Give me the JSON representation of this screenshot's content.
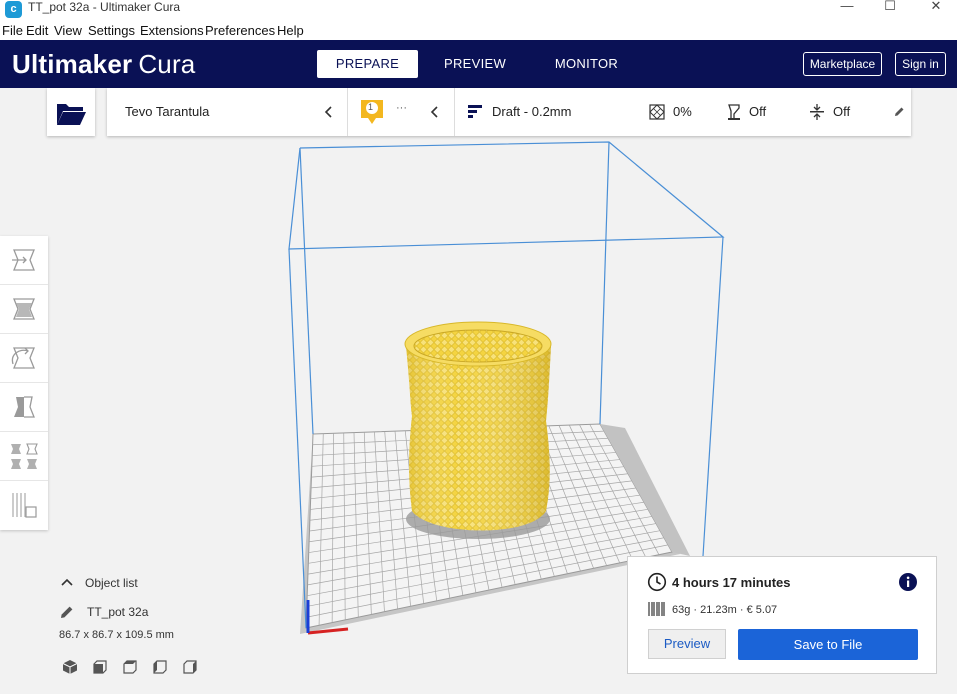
{
  "window": {
    "title": "TT_pot 32a - Ultimaker Cura",
    "app_icon_letter": "c",
    "minimize": "—",
    "maximize": "☐",
    "close": "✕"
  },
  "menu": [
    "File",
    "Edit",
    "View",
    "Settings",
    "Extensions",
    "Preferences",
    "Help"
  ],
  "header": {
    "logo_bold": "Ultimaker",
    "logo_light": "Cura",
    "tabs": [
      {
        "label": "PREPARE",
        "active": true
      },
      {
        "label": "PREVIEW",
        "active": false
      },
      {
        "label": "MONITOR",
        "active": false
      }
    ],
    "marketplace": "Marketplace",
    "sign_in": "Sign in"
  },
  "toolbar": {
    "printer_name": "Tevo Tarantula",
    "extruder_number": "1",
    "extruder_more": "···",
    "profile": "Draft - 0.2mm",
    "infill": "0%",
    "support": "Off",
    "adhesion": "Off"
  },
  "object_list": {
    "header": "Object list",
    "object_name": "TT_pot 32a",
    "dimensions": "86.7 x 86.7 x 109.5 mm"
  },
  "print_info": {
    "time": "4 hours 17 minutes",
    "material": "63g · 21.23m · € 5.07",
    "preview_label": "Preview",
    "save_label": "Save to File"
  },
  "colors": {
    "header_bg": "#0a1155",
    "accent_blue": "#1b64d8",
    "model_yellow": "#f5d94a",
    "buildvolume_line": "#4a8fd6"
  }
}
